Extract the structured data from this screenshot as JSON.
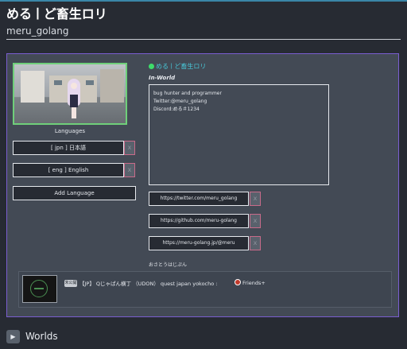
{
  "profile": {
    "display_name": "めるㅣど畜生ロリ",
    "username": "meru_golang",
    "status_label": "めるㅣど畜生ロリ",
    "location": "In-World"
  },
  "colors": {
    "accent_border": "#7a5ed0",
    "online": "#3ddc6a",
    "status_text": "#48c6d6",
    "remove_button_border": "#c96b8a"
  },
  "languages": {
    "title": "Languages",
    "items": [
      "[ jpn ] 日本語",
      "[ eng ] English"
    ],
    "remove_icon": "x",
    "add_label": "Add Language"
  },
  "bio": {
    "lines": [
      "bug hunter and programmer",
      "",
      "Twitter:@meru_golang",
      "Discord:める＃1234"
    ]
  },
  "links": [
    "https://twitter.com/meru_golang",
    "https://github.com/meru-golang",
    "https://meru-golang.jp/@meru"
  ],
  "note": "おさとうはじぷん",
  "world": {
    "badge": "未公開",
    "name": "【JP】 Qじゃぱん横丁 （UDON） quest japan yokocho :",
    "access": "Friends+"
  },
  "section": {
    "worlds_icon": "play-icon",
    "worlds_title": "Worlds"
  }
}
